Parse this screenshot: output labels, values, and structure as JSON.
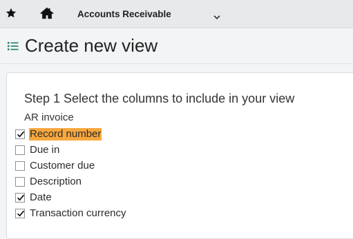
{
  "topbar": {
    "favorites_icon": "star-icon",
    "home_icon": "home-icon",
    "app_name": "Accounts Receivable",
    "dropdown_icon": "chevron-down-icon"
  },
  "header": {
    "icon": "list-icon",
    "title": "Create new view"
  },
  "step": {
    "heading": "Step 1 Select the columns to include in your view",
    "group": "AR invoice",
    "columns": [
      {
        "label": "Record number",
        "checked": true,
        "highlighted": true
      },
      {
        "label": "Due in",
        "checked": false,
        "highlighted": false
      },
      {
        "label": "Customer due",
        "checked": false,
        "highlighted": false
      },
      {
        "label": "Description",
        "checked": false,
        "highlighted": false
      },
      {
        "label": "Date",
        "checked": true,
        "highlighted": false
      },
      {
        "label": "Transaction currency",
        "checked": true,
        "highlighted": false
      }
    ]
  },
  "colors": {
    "highlight": "#f7a73e",
    "accent": "#1f7a6a"
  }
}
